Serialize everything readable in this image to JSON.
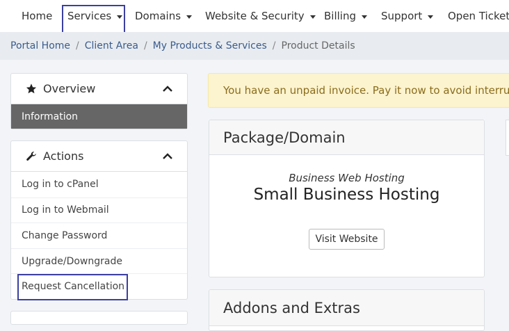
{
  "nav": {
    "home": "Home",
    "services": "Services",
    "domains": "Domains",
    "website_security": "Website & Security",
    "billing": "Billing",
    "support": "Support",
    "open_ticket": "Open Ticket"
  },
  "breadcrumb": {
    "items": [
      "Portal Home",
      "Client Area",
      "My Products & Services"
    ],
    "current": "Product Details",
    "separator": "/"
  },
  "sidebar": {
    "overview": {
      "title": "Overview",
      "active_item": "Information"
    },
    "actions": {
      "title": "Actions",
      "items": [
        "Log in to cPanel",
        "Log in to Webmail",
        "Change Password",
        "Upgrade/Downgrade",
        "Request Cancellation"
      ]
    }
  },
  "alert": {
    "text": "You have an unpaid invoice. Pay it now to avoid interruption in service."
  },
  "package": {
    "title": "Package/Domain",
    "group": "Business Web Hosting",
    "name": "Small Business Hosting",
    "visit_label": "Visit Website"
  },
  "addons": {
    "title": "Addons and Extras"
  },
  "colors": {
    "highlight": "#3b3fa0",
    "active_item_bg": "#666666",
    "alert_bg": "#fcf3cf",
    "link": "#3b5b8c"
  }
}
